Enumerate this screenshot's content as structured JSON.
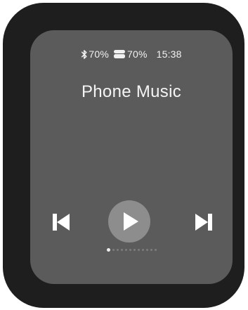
{
  "status_bar": {
    "bluetooth_icon": "bluetooth-icon",
    "bluetooth_battery": "70%",
    "case_icon": "earbuds-case-icon",
    "case_battery": "70%",
    "time": "15:38"
  },
  "title": "Phone Music",
  "controls": {
    "previous_icon": "skip-previous-icon",
    "play_icon": "play-icon",
    "next_icon": "skip-next-icon"
  },
  "pagination": {
    "total_pages": 12,
    "current_page": 1
  },
  "colors": {
    "bezel": "#1e1e1e",
    "screen": "#5b5b5b",
    "play_button": "#8d8d8d",
    "foreground": "#f4f4f4"
  }
}
